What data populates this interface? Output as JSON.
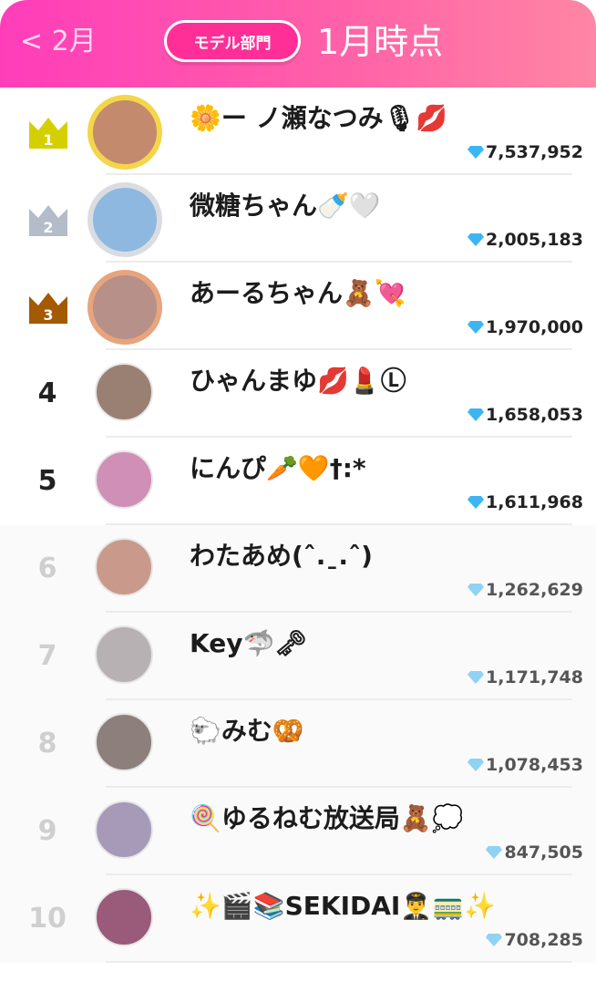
{
  "header": {
    "prev_label": "< 2月",
    "category_label": "モデル部門",
    "month_label": "1月時点"
  },
  "colors": {
    "header_start": "#ff3dba",
    "header_end": "#ff86a4",
    "gold": "#d6cf00",
    "silver": "#b3bcc8",
    "bronze": "#a35a00",
    "diamond": "#3bb6f2"
  },
  "rankings": [
    {
      "rank": "1",
      "name": "🌼ー ノ瀬なつみ🎙💋",
      "score": "7,537,952",
      "badge": "gold-crown-icon",
      "avatar_color": "#c48a6e"
    },
    {
      "rank": "2",
      "name": "微糖ちゃん🍼🤍",
      "score": "2,005,183",
      "badge": "silver-crown-icon",
      "avatar_color": "#8fb8e0"
    },
    {
      "rank": "3",
      "name": "あーるちゃん🧸💘",
      "score": "1,970,000",
      "badge": "bronze-crown-icon",
      "avatar_color": "#b79089"
    },
    {
      "rank": "4",
      "name": "ひゃんまゆ💋💄Ⓛ",
      "score": "1,658,053",
      "badge": "",
      "avatar_color": "#9a7f73"
    },
    {
      "rank": "5",
      "name": "にんぴ🥕🧡†:*",
      "score": "1,611,968",
      "badge": "",
      "avatar_color": "#d08fb7"
    },
    {
      "rank": "6",
      "name": "わたあめ(ˆ.ˍ.ˆ)",
      "score": "1,262,629",
      "badge": "",
      "avatar_color": "#c99a8c"
    },
    {
      "rank": "7",
      "name": "Key🦈🗝",
      "score": "1,171,748",
      "badge": "",
      "avatar_color": "#b7b1b3"
    },
    {
      "rank": "8",
      "name": "🐑みむ🥨",
      "score": "1,078,453",
      "badge": "",
      "avatar_color": "#8c7f7c"
    },
    {
      "rank": "9",
      "name": "🍭ゆるねむ放送局🧸💭",
      "score": "847,505",
      "badge": "",
      "avatar_color": "#a79ab8"
    },
    {
      "rank": "10",
      "name": "✨🎬📚SEKIDAI👨‍✈️🚃✨",
      "score": "708,285",
      "badge": "",
      "avatar_color": "#9a5a7a"
    }
  ]
}
